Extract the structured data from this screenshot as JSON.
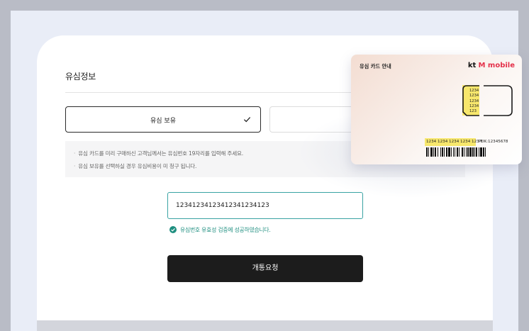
{
  "section": {
    "title": "유심정보"
  },
  "options": [
    {
      "label": "유심 보유",
      "selected": true
    },
    {
      "label": "",
      "selected": false
    }
  ],
  "notices": [
    "유심 카드를 미리 구매하신 고객님께서는 유심번호 19자리를 입력해 주세요.",
    "유심 보유를 선택하실 경우 유심비용이 미 청구 됩니다."
  ],
  "usim_input": {
    "value": "12341234123412341234123"
  },
  "validation": {
    "message": "유심번호 유효성 검증에 성공하였습니다.",
    "status_color": "#1f8f80"
  },
  "submit": {
    "label": "개통요청"
  },
  "sim_card": {
    "title": "유심 카드 안내",
    "brand_kt": "kt",
    "brand_m": "M mobile",
    "chip_numbers": [
      "1234",
      "1234",
      "1234",
      "1234",
      "123"
    ],
    "serial": "1234 1234 1234 1234 123",
    "serial_suffix": "F",
    "puk": "PUK:12345678"
  },
  "colors": {
    "accent": "#1f8f80",
    "input_border": "#3aa3a3",
    "button": "#1c1c1c",
    "brand_red": "#e4314a",
    "chip": "#f7e76c"
  }
}
